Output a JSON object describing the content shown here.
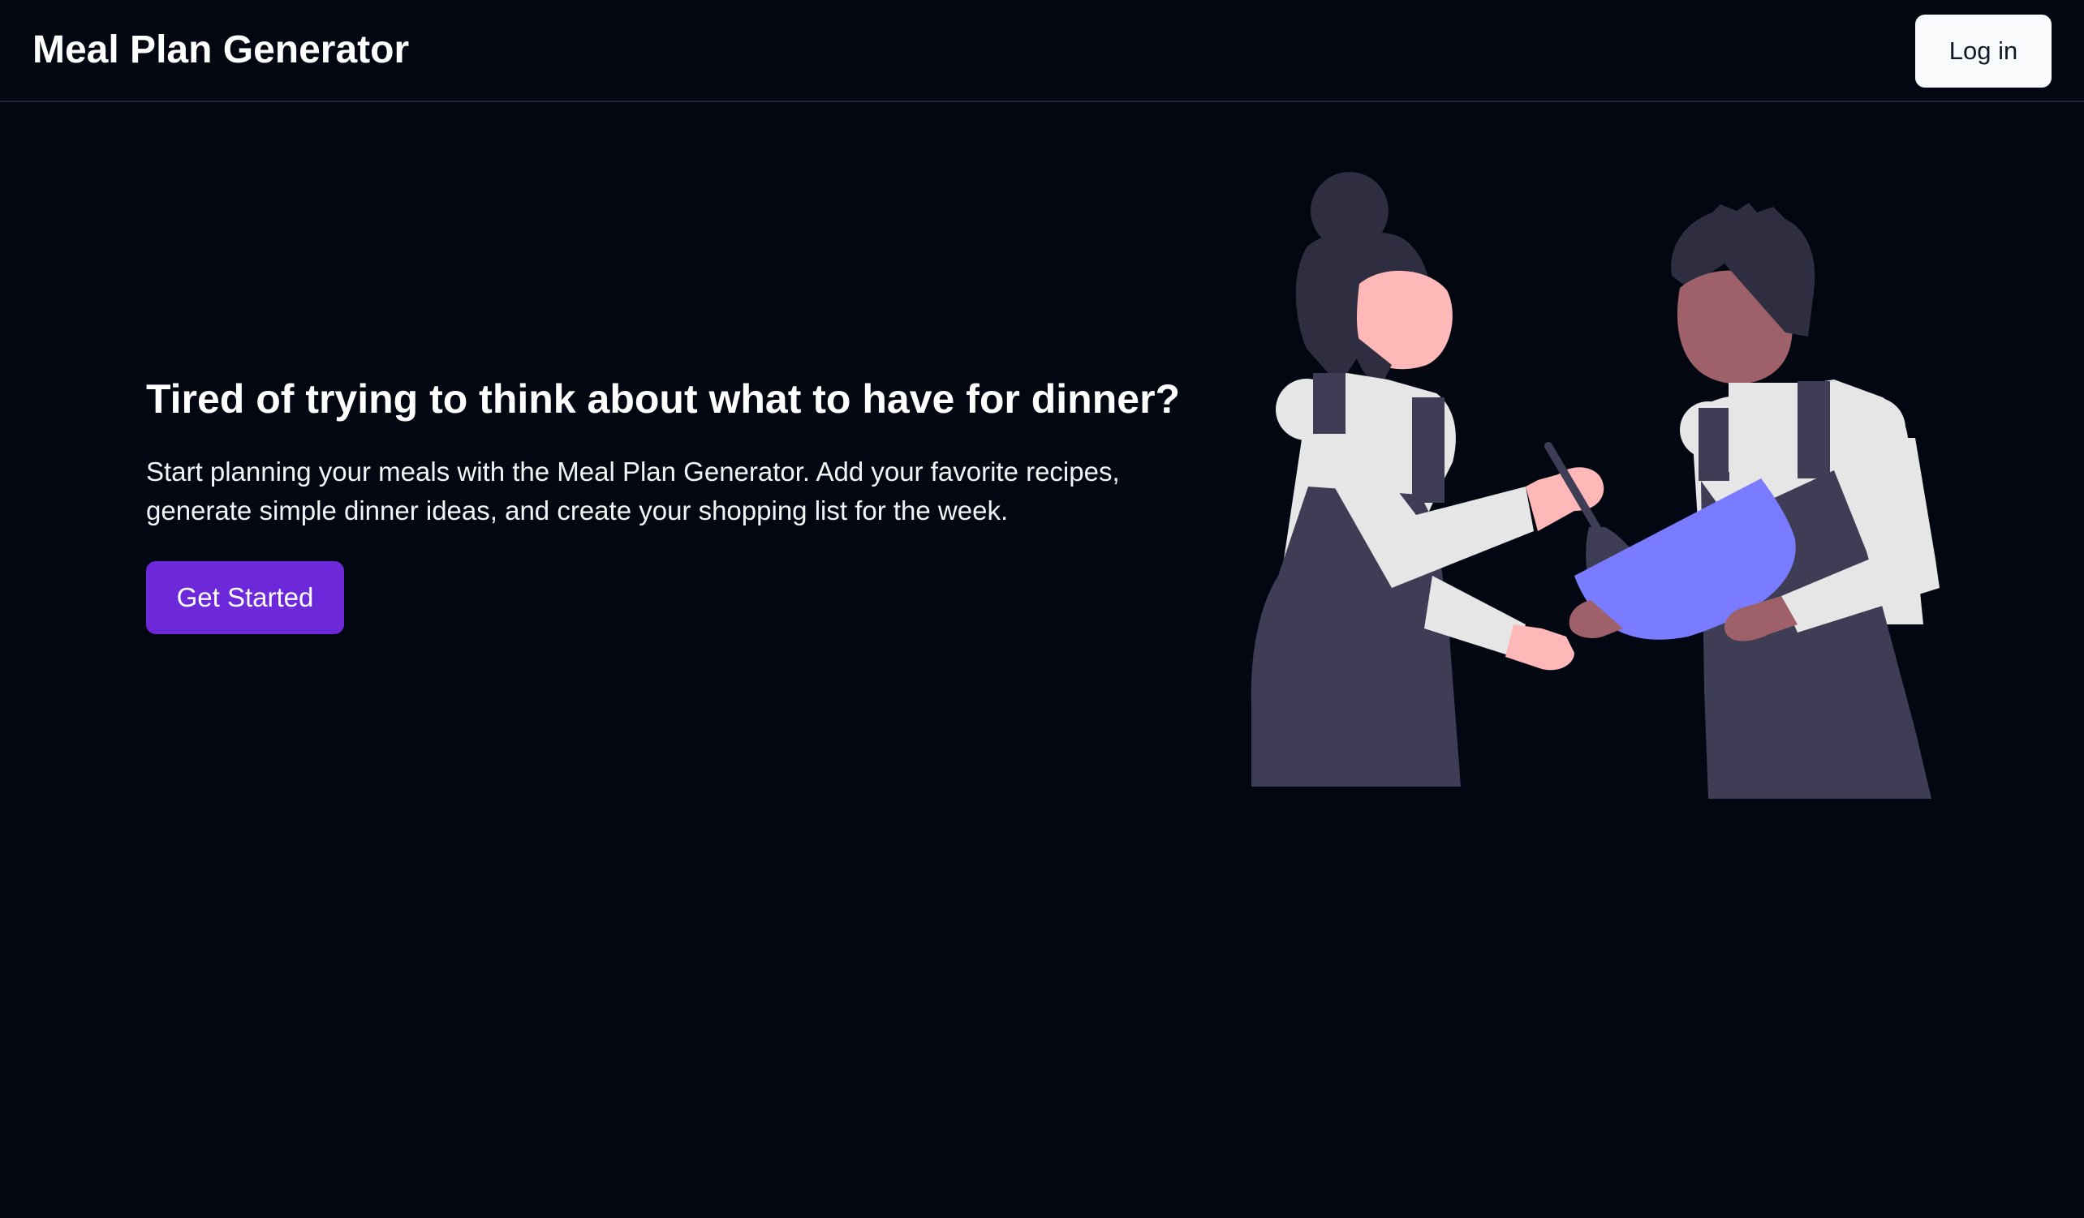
{
  "header": {
    "title": "Meal Plan Generator",
    "login_label": "Log in"
  },
  "hero": {
    "heading": "Tired of trying to think about what to have for dinner?",
    "description": "Start planning your meals with the Meal Plan Generator. Add your favorite recipes, generate simple dinner ideas, and create your shopping list for the week.",
    "cta_label": "Get Started"
  },
  "illustration": {
    "icon": "two-people-cooking-illustration"
  },
  "colors": {
    "background": "#030712",
    "accent": "#6d28d9",
    "bowl": "#7a7cff",
    "apron": "#3f3d56",
    "shirt": "#e6e6e6"
  }
}
